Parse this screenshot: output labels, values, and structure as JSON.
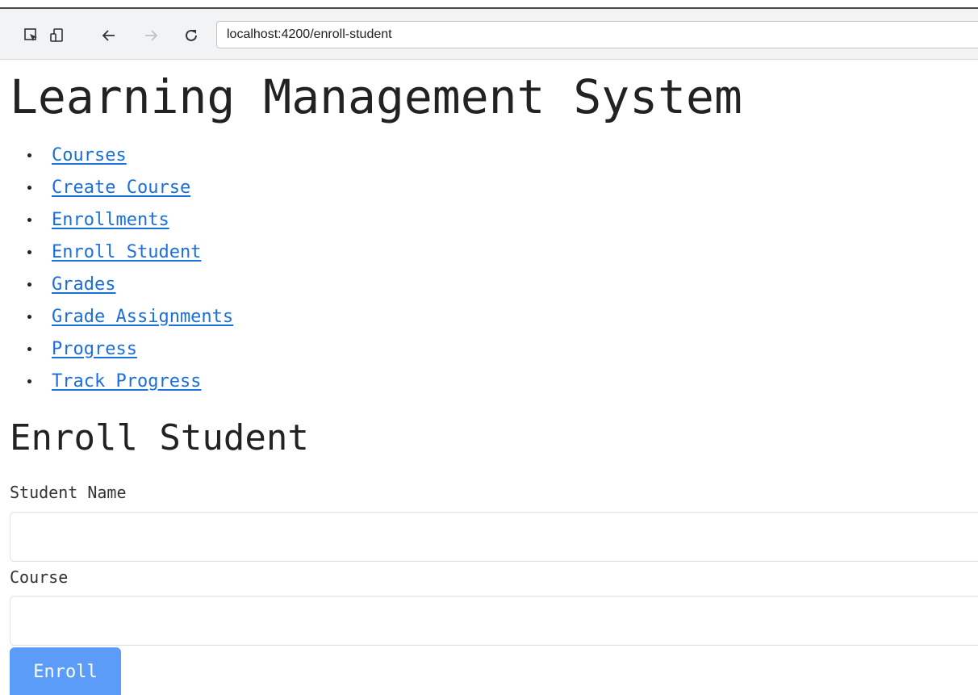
{
  "browser": {
    "url": "localhost:4200/enroll-student",
    "icons": [
      "inspect-icon",
      "device-toolbar-icon",
      "back-icon",
      "forward-icon",
      "reload-icon"
    ]
  },
  "app": {
    "title": "Learning Management System"
  },
  "nav": {
    "items": [
      {
        "label": "Courses"
      },
      {
        "label": "Create Course"
      },
      {
        "label": "Enrollments"
      },
      {
        "label": "Enroll Student"
      },
      {
        "label": "Grades"
      },
      {
        "label": "Grade Assignments"
      },
      {
        "label": "Progress"
      },
      {
        "label": "Track Progress"
      }
    ]
  },
  "form": {
    "title": "Enroll Student",
    "student_name_label": "Student Name",
    "student_name_value": "",
    "course_label": "Course",
    "course_value": "",
    "submit_label": "Enroll"
  },
  "colors": {
    "link": "#1a6fdb",
    "button": "#5a9cf8",
    "text": "#222222"
  }
}
